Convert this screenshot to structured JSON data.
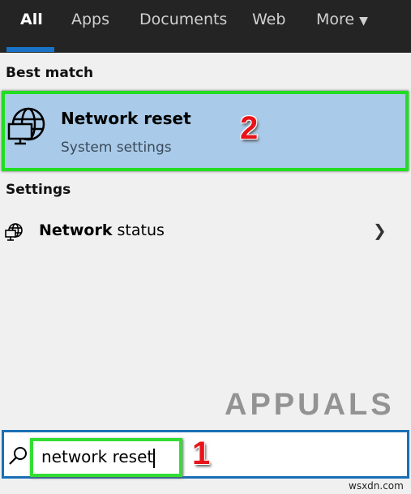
{
  "tabs": [
    {
      "label": "All",
      "active": true
    },
    {
      "label": "Apps"
    },
    {
      "label": "Documents"
    },
    {
      "label": "Web"
    },
    {
      "label": "More"
    }
  ],
  "best_match": {
    "heading": "Best match",
    "title": "Network reset",
    "subtitle": "System settings",
    "icon": "globe-monitor-icon"
  },
  "settings": {
    "heading": "Settings",
    "items": [
      {
        "bold": "Network",
        "rest": " status",
        "icon": "network-icon"
      }
    ]
  },
  "annotations": {
    "step1": "1",
    "step2": "2"
  },
  "watermark": "APPUALS",
  "search": {
    "value": "network reset"
  },
  "footer": "wsxdn.com",
  "colors": {
    "highlight": "#a9cae8",
    "annotation_box": "#22dd22",
    "accent": "#1a73c8"
  }
}
